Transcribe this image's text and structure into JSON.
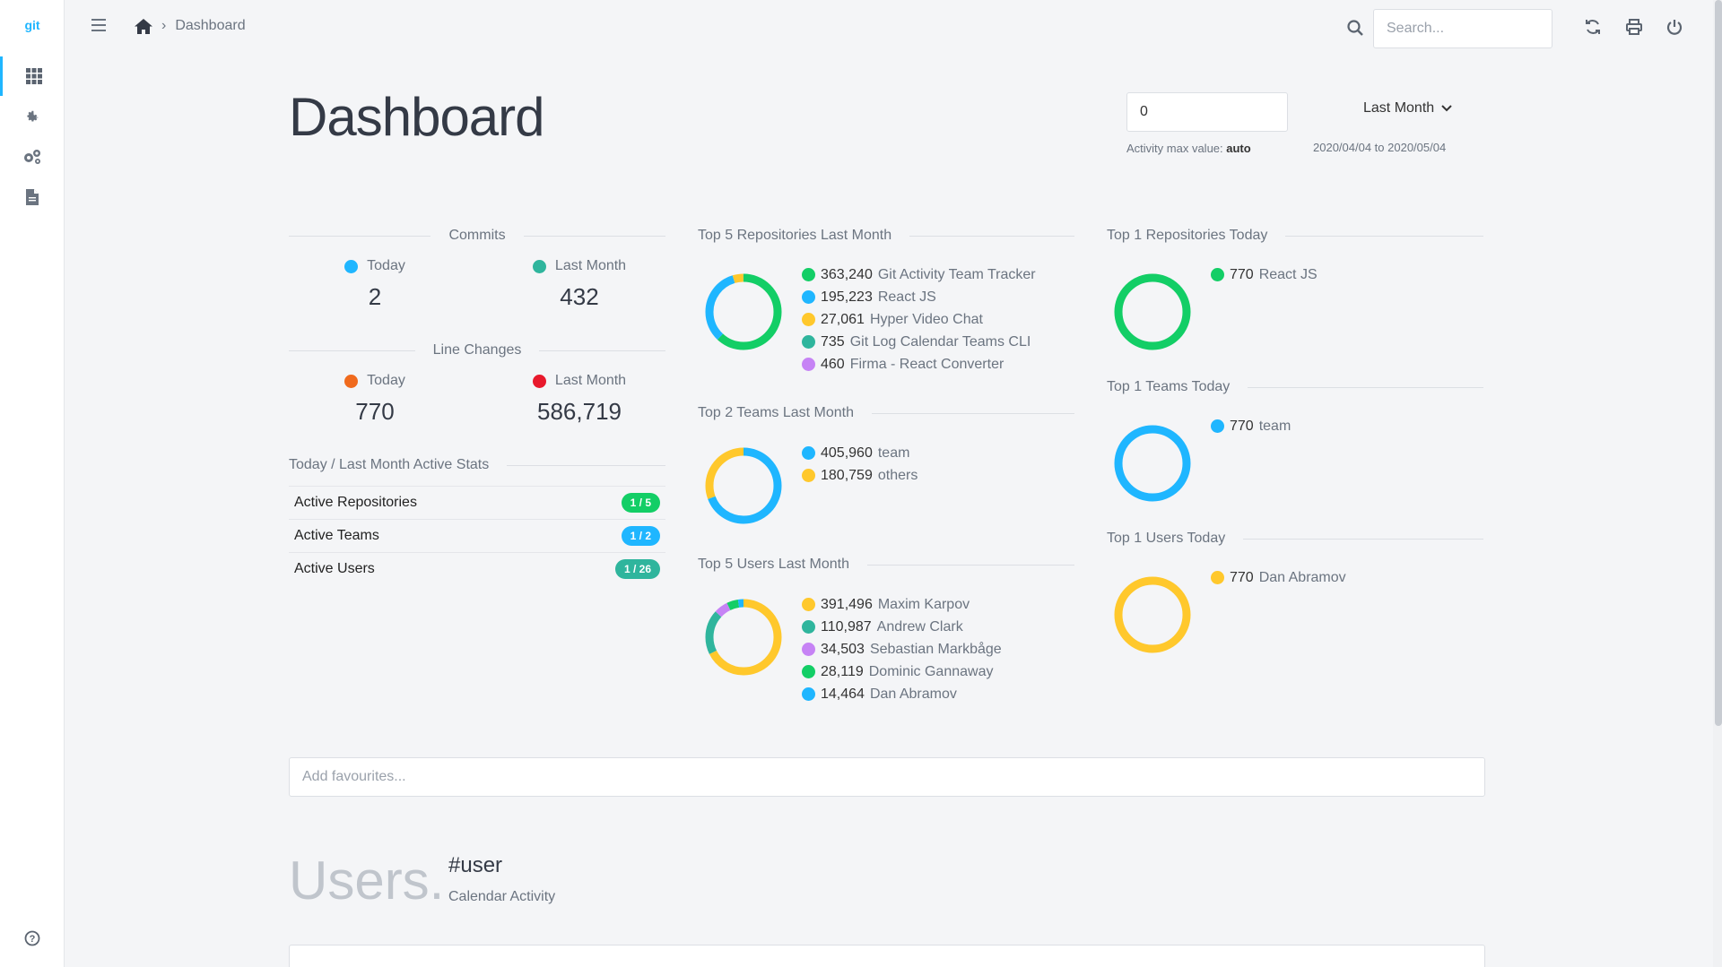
{
  "app": {
    "logo": "git"
  },
  "sidebar": {
    "items": [
      {
        "icon": "grid-icon",
        "active": true
      },
      {
        "icon": "gear-icon",
        "active": false
      },
      {
        "icon": "gears-icon",
        "active": false
      },
      {
        "icon": "document-icon",
        "active": false
      }
    ],
    "help_icon": "help-circle-icon"
  },
  "topbar": {
    "breadcrumb": {
      "home_icon": "home-icon",
      "current": "Dashboard"
    },
    "search": {
      "placeholder": "Search..."
    },
    "icons": [
      "refresh-icon",
      "print-icon",
      "power-icon"
    ]
  },
  "header": {
    "title": "Dashboard",
    "activity_max_input": "0",
    "activity_note_label": "Activity max value: ",
    "activity_note_value": "auto",
    "range_select": "Last Month",
    "date_range": "2020/04/04 to 2020/05/04"
  },
  "stats": {
    "commits": {
      "title": "Commits",
      "today_label": "Today",
      "today_value": "2",
      "today_color": "#1fb6ff",
      "month_label": "Last Month",
      "month_value": "432",
      "month_color": "#2fb59d"
    },
    "line_changes": {
      "title": "Line Changes",
      "today_label": "Today",
      "today_value": "770",
      "today_color": "#f06a1d",
      "month_label": "Last Month",
      "month_value": "586,719",
      "month_color": "#e8192c"
    },
    "active": {
      "title": "Today / Last Month Active Stats",
      "rows": [
        {
          "label": "Active Repositories",
          "badge": "1 / 5",
          "color": "#13ce66"
        },
        {
          "label": "Active Teams",
          "badge": "1 / 2",
          "color": "#1fb6ff"
        },
        {
          "label": "Active Users",
          "badge": "1 / 26",
          "color": "#2fb59d"
        }
      ]
    }
  },
  "chart_data": [
    {
      "type": "pie",
      "title": "Top 5 Repositories Last Month",
      "series": [
        {
          "name": "Git Activity Team Tracker",
          "value": 363240,
          "label": "363,240",
          "color": "#13ce66"
        },
        {
          "name": "React JS",
          "value": 195223,
          "label": "195,223",
          "color": "#1fb6ff"
        },
        {
          "name": "Hyper Video Chat",
          "value": 27061,
          "label": "27,061",
          "color": "#ffc82c"
        },
        {
          "name": "Git Log Calendar Teams CLI",
          "value": 735,
          "label": "735",
          "color": "#2fb59d"
        },
        {
          "name": "Firma - React Converter",
          "value": 460,
          "label": "460",
          "color": "#c683f5"
        }
      ]
    },
    {
      "type": "pie",
      "title": "Top 2 Teams Last Month",
      "series": [
        {
          "name": "team",
          "value": 405960,
          "label": "405,960",
          "color": "#1fb6ff"
        },
        {
          "name": "others",
          "value": 180759,
          "label": "180,759",
          "color": "#ffc82c"
        }
      ]
    },
    {
      "type": "pie",
      "title": "Top 5 Users Last Month",
      "series": [
        {
          "name": "Maxim Karpov",
          "value": 391496,
          "label": "391,496",
          "color": "#ffc82c"
        },
        {
          "name": "Andrew Clark",
          "value": 110987,
          "label": "110,987",
          "color": "#2fb59d"
        },
        {
          "name": "Sebastian Markbåge",
          "value": 34503,
          "label": "34,503",
          "color": "#c683f5"
        },
        {
          "name": "Dominic Gannaway",
          "value": 28119,
          "label": "28,119",
          "color": "#13ce66"
        },
        {
          "name": "Dan Abramov",
          "value": 14464,
          "label": "14,464",
          "color": "#1fb6ff"
        }
      ]
    },
    {
      "type": "pie",
      "title": "Top 1 Repositories Today",
      "series": [
        {
          "name": "React JS",
          "value": 770,
          "label": "770",
          "color": "#13ce66"
        }
      ]
    },
    {
      "type": "pie",
      "title": "Top 1 Teams Today",
      "series": [
        {
          "name": "team",
          "value": 770,
          "label": "770",
          "color": "#1fb6ff"
        }
      ]
    },
    {
      "type": "pie",
      "title": "Top 1 Users Today",
      "series": [
        {
          "name": "Dan Abramov",
          "value": 770,
          "label": "770",
          "color": "#ffc82c"
        }
      ]
    }
  ],
  "favourites": {
    "placeholder": "Add favourites..."
  },
  "users_section": {
    "title": "Users.",
    "tag": "#user",
    "subtitle": "Calendar Activity"
  }
}
